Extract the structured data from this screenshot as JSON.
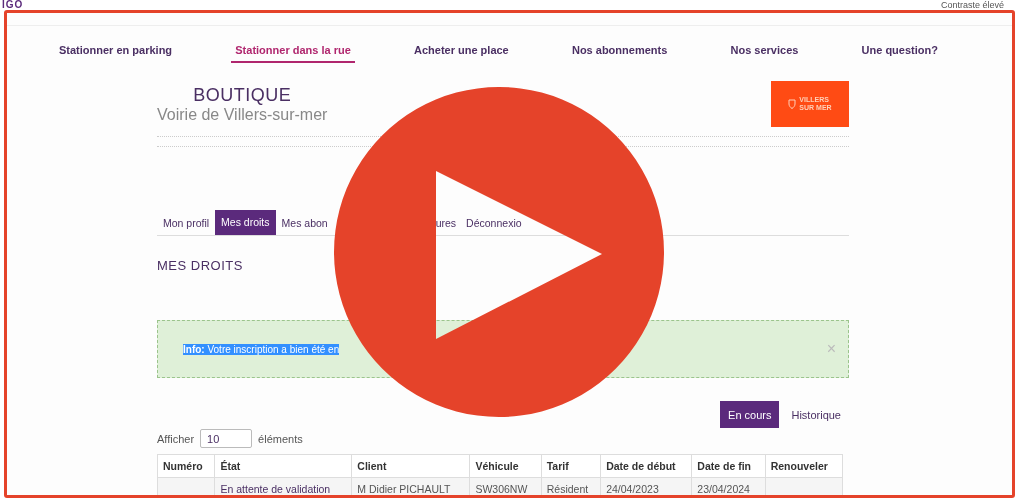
{
  "header": {
    "logo": "IGO",
    "contrast_link": "Contraste élevé"
  },
  "nav": [
    {
      "label": "Stationner en parking",
      "selected": false
    },
    {
      "label": "Stationner dans la rue",
      "selected": true
    },
    {
      "label": "Acheter une place",
      "selected": false
    },
    {
      "label": "Nos abonnements",
      "selected": false
    },
    {
      "label": "Nos services",
      "selected": false
    },
    {
      "label": "Une question?",
      "selected": false
    }
  ],
  "shop": {
    "title": "BOUTIQUE",
    "subtitle": "Voirie de Villers-sur-mer",
    "logo_lines": [
      "VILLERS",
      "SUR MER"
    ]
  },
  "tabs": [
    {
      "label": "Mon profil",
      "selected": false
    },
    {
      "label": "Mes droits",
      "selected": true
    },
    {
      "label": "Mes abon",
      "selected": false
    },
    {
      "label": "ures",
      "selected": false
    },
    {
      "label": "Déconnexio",
      "selected": false
    }
  ],
  "section_title": "MES DROITS",
  "alert": {
    "text": "**Info:** Votre inscription a bien été en",
    "close": "×"
  },
  "view_toggle": [
    {
      "label": "En cours",
      "selected": true
    },
    {
      "label": "Historique",
      "selected": false
    }
  ],
  "page_length": {
    "prefix": "Afficher",
    "value": "10",
    "suffix": "éléments"
  },
  "table": {
    "columns": [
      "Numéro",
      "État",
      "Client",
      "Véhicule",
      "Tarif",
      "Date de début",
      "Date de fin",
      "Renouveler"
    ],
    "rows": [
      [
        "",
        "En attente de validation",
        "M Didier PICHAULT",
        "SW306NW",
        "Résident",
        "24/04/2023",
        "23/04/2024",
        ""
      ]
    ]
  }
}
